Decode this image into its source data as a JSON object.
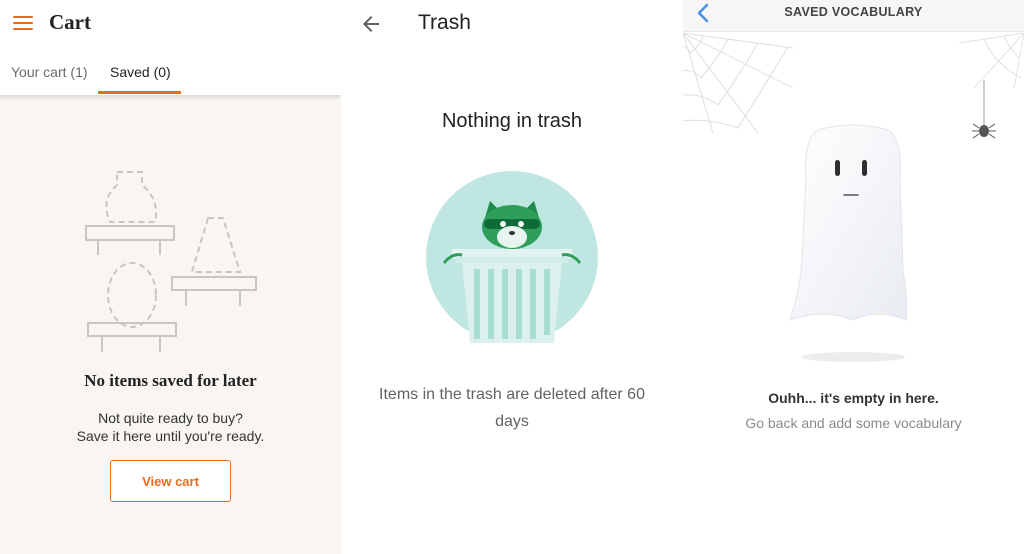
{
  "cart": {
    "title": "Cart",
    "tabs": [
      {
        "label": "Your cart (1)"
      },
      {
        "label": "Saved (0)"
      }
    ],
    "empty_title": "No items saved for later",
    "empty_sub_line1": "Not quite ready to buy?",
    "empty_sub_line2": "Save it here until you're ready.",
    "view_cart_label": "View cart",
    "accent_color": "#e66d1e"
  },
  "trash": {
    "title": "Trash",
    "heading": "Nothing in trash",
    "note": "Items in the trash are deleted after 60 days",
    "accent_color": "#2e9e5b",
    "circle_color": "#bfe6e1"
  },
  "vocab": {
    "title": "SAVED VOCABULARY",
    "empty_title": "Ouhh... it's empty in here.",
    "empty_sub": "Go back and add some vocabulary",
    "back_color": "#4a90e2"
  },
  "icons": [
    "menu-icon",
    "back-arrow-icon",
    "chevron-left-icon",
    "raccoon-trash-illustration",
    "ghost-illustration",
    "spider-icon",
    "furniture-outline-illustration"
  ]
}
